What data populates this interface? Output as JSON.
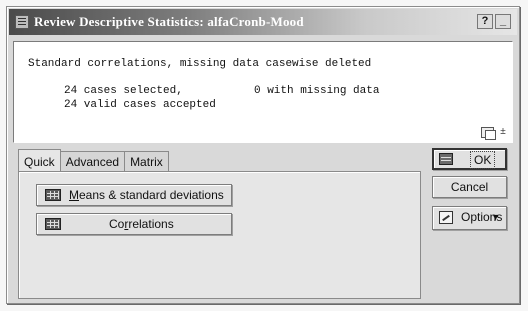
{
  "window": {
    "title": "Review Descriptive Statistics: alfaCronb-Mood",
    "help_label": "?",
    "minimize_label": "_"
  },
  "output": {
    "line1": "Standard correlations, missing data casewise deleted",
    "line2": "24 cases selected,",
    "line2b": "0 with missing data",
    "line3": "24 valid cases accepted"
  },
  "tabs": [
    {
      "label": "Quick",
      "active": true
    },
    {
      "label": "Advanced",
      "active": false
    },
    {
      "label": "Matrix",
      "active": false
    }
  ],
  "quick_panel": {
    "means_mnemonic": "M",
    "means_rest": "eans & standard deviations",
    "corr_pre": "Co",
    "corr_mnemonic": "r",
    "corr_rest": "relations"
  },
  "side_buttons": {
    "ok_label": "OK",
    "cancel_label": "Cancel",
    "options_label": "Options",
    "options_arrow": "▼"
  },
  "icons": {
    "window_icon": "statistics-app-icon",
    "copy_icon": "copy-icon",
    "pin_icon": "pin-icon",
    "means_icon": "table-grid-icon",
    "corr_icon": "table-grid-icon",
    "ok_icon": "table-grid-icon",
    "options_icon": "options-icon"
  }
}
